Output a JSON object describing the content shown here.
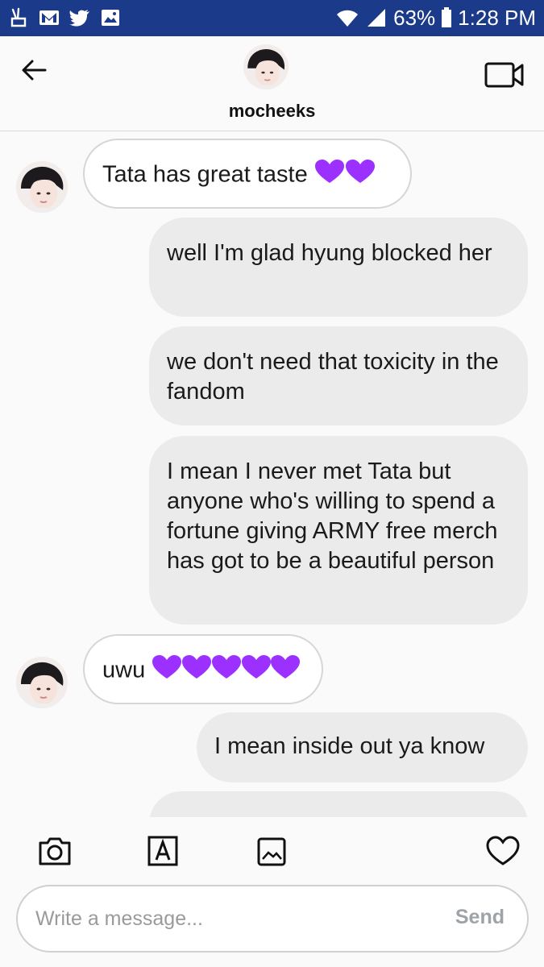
{
  "status_bar": {
    "battery": "63%",
    "time": "1:28 PM",
    "left_icons": [
      "v-sign-icon",
      "mail-icon",
      "twitter-icon",
      "image-icon"
    ],
    "right_icons": [
      "wifi-icon",
      "signal-icon",
      "battery-icon"
    ]
  },
  "header": {
    "username": "mocheeks",
    "back_icon": "arrow-left-icon",
    "video_icon": "video-camera-icon"
  },
  "messages": [
    {
      "from": "them",
      "text": "Tata has great taste",
      "hearts": 2
    },
    {
      "from": "me",
      "text": "well I'm glad hyung blocked her"
    },
    {
      "from": "me",
      "text": "we don't need that toxicity in the fandom"
    },
    {
      "from": "me",
      "text": "I mean I never met Tata but anyone who's willing to spend a fortune giving ARMY free merch has got to be a beautiful person"
    },
    {
      "from": "them",
      "text": "uwu",
      "hearts": 5
    },
    {
      "from": "me",
      "text": "I mean inside out ya know"
    }
  ],
  "composer": {
    "placeholder": "Write a message...",
    "send_label": "Send",
    "tools": [
      "camera-icon",
      "text-icon",
      "gallery-icon",
      "heart-icon"
    ]
  },
  "colors": {
    "status_bar": "#1b3a8a",
    "heart": "#9b30ff",
    "outgoing_bubble": "#ebebeb",
    "incoming_border": "#d6d6d6"
  }
}
